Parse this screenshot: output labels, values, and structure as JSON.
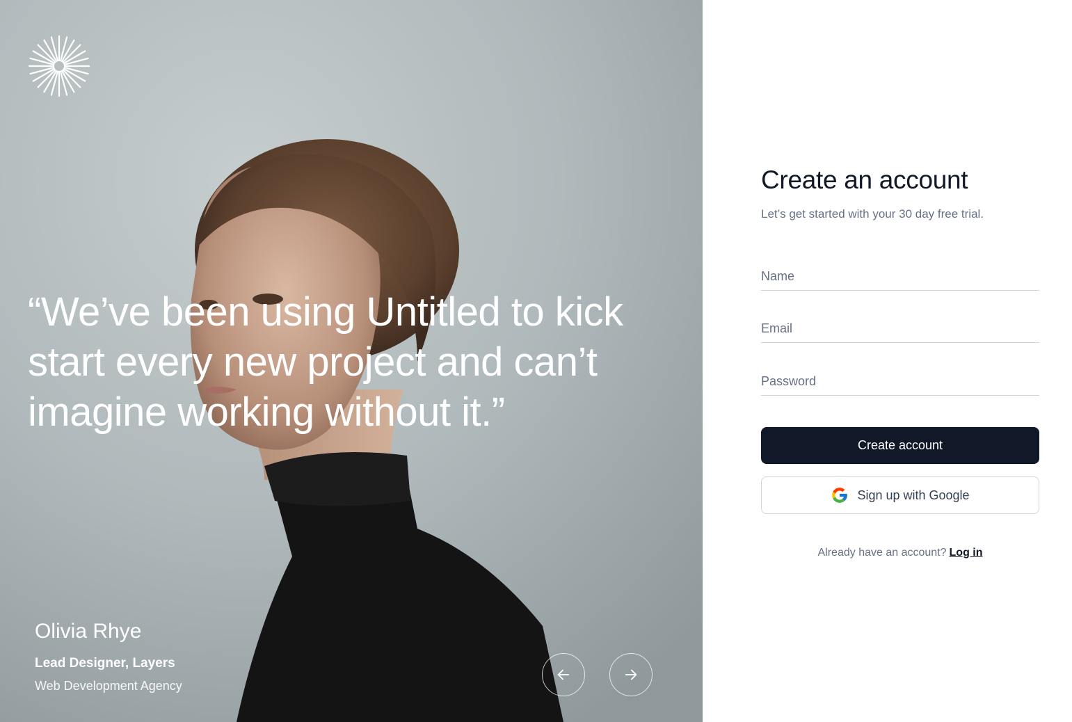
{
  "hero": {
    "quote": "“We’ve been using Untitled to kick start every new project and can’t imagine working without it.”",
    "author_name": "Olivia Rhye",
    "author_role": "Lead Designer, Layers",
    "author_company": "Web Development Agency",
    "logo_icon": "starburst-logo-icon",
    "prev_icon": "arrow-left-icon",
    "next_icon": "arrow-right-icon"
  },
  "form": {
    "title": "Create an account",
    "subtitle": "Let’s get started with your 30 day free trial.",
    "name_placeholder": "Name",
    "email_placeholder": "Email",
    "password_placeholder": "Password",
    "name_value": "",
    "email_value": "",
    "password_value": "",
    "submit_label": "Create account",
    "google_label": "Sign up with Google",
    "google_icon": "google-icon",
    "login_prompt": "Already have an account?",
    "login_link": "Log in"
  },
  "colors": {
    "primary": "#111827",
    "muted_text": "#667085",
    "border": "#d0d5dd",
    "hero_bg": "#b3bcbe"
  }
}
